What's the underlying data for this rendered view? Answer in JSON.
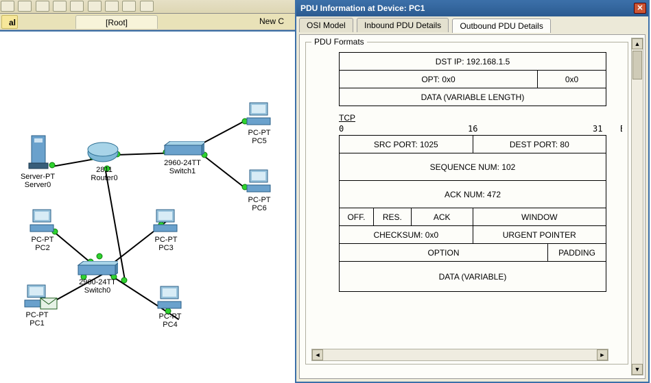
{
  "toolbar": {
    "root_tab": "[Root]",
    "new_cluster": "New C",
    "al_label": "al"
  },
  "topology": {
    "server": {
      "line1": "Server-PT",
      "line2": "Server0"
    },
    "router": {
      "line1": "2811",
      "line2": "Router0"
    },
    "switch1": {
      "line1": "2960-24TT",
      "line2": "Switch1"
    },
    "switch0": {
      "line1": "2960-24TT",
      "line2": "Switch0"
    },
    "pc1": {
      "line1": "PC-PT",
      "line2": "PC1"
    },
    "pc2": {
      "line1": "PC-PT",
      "line2": "PC2"
    },
    "pc3": {
      "line1": "PC-PT",
      "line2": "PC3"
    },
    "pc4": {
      "line1": "PC-PT",
      "line2": "PC4"
    },
    "pc5": {
      "line1": "PC-PT",
      "line2": "PC5"
    },
    "pc6": {
      "line1": "PC-PT",
      "line2": "PC6"
    }
  },
  "pdu": {
    "window_title": "PDU Information at Device: PC1",
    "tabs": {
      "osi": "OSI Model",
      "inbound": "Inbound PDU Details",
      "outbound": "Outbound PDU Details"
    },
    "group_label": "PDU Formats",
    "ip": {
      "dst_ip": "DST IP: 192.168.1.5",
      "opt": "OPT: 0x0",
      "opt_pad": "0x0",
      "data": "DATA (VARIABLE LENGTH)"
    },
    "tcp_label": "TCP",
    "bits": {
      "b0": "0",
      "b16": "16",
      "b31": "31",
      "label": "Bits"
    },
    "tcp": {
      "src_port": "SRC PORT: 1025",
      "dst_port": "DEST PORT: 80",
      "seq": "SEQUENCE NUM: 102",
      "ack": "ACK NUM: 472",
      "off": "OFF.",
      "res": "RES.",
      "flags": "ACK",
      "window": "WINDOW",
      "checksum": "CHECKSUM: 0x0",
      "urgent": "URGENT POINTER",
      "option": "OPTION",
      "padding": "PADDING",
      "data": "DATA (VARIABLE)"
    }
  }
}
